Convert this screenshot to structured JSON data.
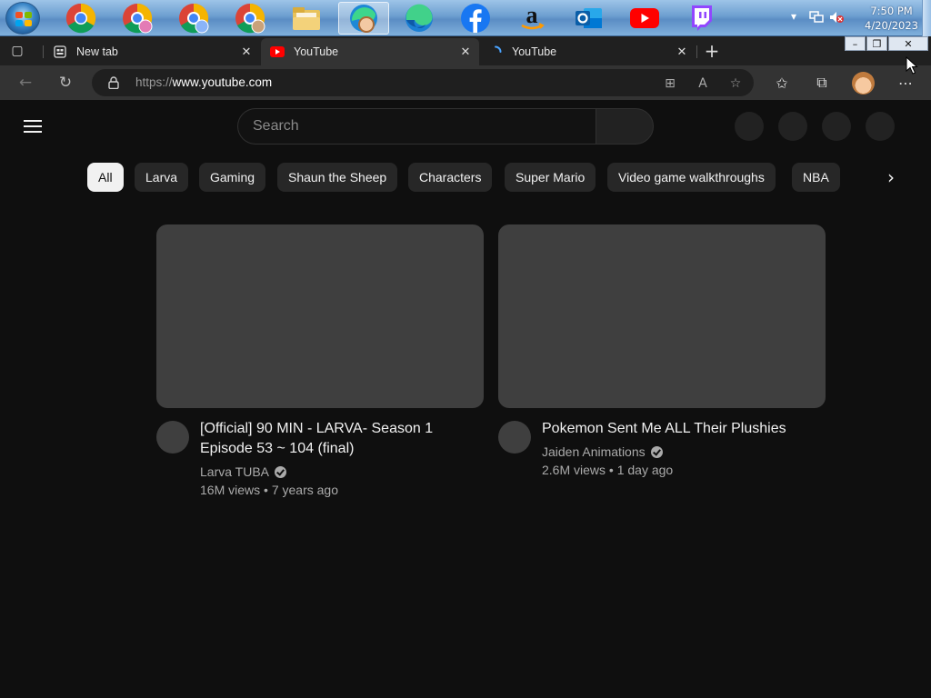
{
  "taskbar": {
    "apps": [
      {
        "name": "Google Chrome",
        "icon": "chrome-icon"
      },
      {
        "name": "Chrome profile 2",
        "icon": "chrome-profile-icon"
      },
      {
        "name": "Chrome profile 3",
        "icon": "chrome-profile-icon"
      },
      {
        "name": "Chrome profile 4",
        "icon": "chrome-profile-icon"
      },
      {
        "name": "File Explorer",
        "icon": "folder-icon"
      },
      {
        "name": "Microsoft Edge (profile)",
        "icon": "edge-profile-icon",
        "active": true
      },
      {
        "name": "Microsoft Edge",
        "icon": "edge-icon"
      },
      {
        "name": "Facebook",
        "icon": "facebook-icon"
      },
      {
        "name": "Amazon",
        "icon": "amazon-icon"
      },
      {
        "name": "Outlook",
        "icon": "outlook-icon"
      },
      {
        "name": "YouTube",
        "icon": "youtube-icon"
      },
      {
        "name": "Twitch",
        "icon": "twitch-icon"
      }
    ],
    "clock": {
      "time": "7:50 PM",
      "date": "4/20/2023"
    },
    "tray_icons": [
      "chevron-up-icon",
      "network-icon",
      "volume-muted-icon"
    ]
  },
  "browser": {
    "tabs": [
      {
        "label": "New tab",
        "icon": "new-tab-page-icon",
        "selected": false
      },
      {
        "label": "YouTube",
        "icon": "youtube-favicon",
        "selected": true
      },
      {
        "label": "YouTube",
        "icon": "loading-spinner-icon",
        "selected": false
      }
    ],
    "window_controls": {
      "minimize": "–",
      "restore": "❐",
      "close": "✕"
    },
    "address": {
      "prefix": "https://",
      "host": "www.youtube.com"
    },
    "toolbar_icons": [
      "apps-icon",
      "read-aloud-icon",
      "add-favorite-icon",
      "favorites-icon",
      "collections-icon",
      "profile-avatar",
      "more-icon"
    ]
  },
  "youtube": {
    "search_placeholder": "Search",
    "chips": [
      "All",
      "Larva",
      "Gaming",
      "Shaun the Sheep",
      "Characters",
      "Super Mario",
      "Video game walkthroughs",
      "NBA"
    ],
    "active_chip": "All",
    "videos": [
      {
        "title": "[Official] 90 MIN - LARVA- Season 1 Episode 53 ~ 104 (final)",
        "channel": "Larva TUBA",
        "verified": true,
        "views": "16M views",
        "age": "7 years ago"
      },
      {
        "title": "Pokemon Sent Me ALL Their Plushies",
        "channel": "Jaiden Animations",
        "verified": true,
        "views": "2.6M views",
        "age": "1 day ago"
      }
    ]
  },
  "colors": {
    "yt_background": "#0f0f0f",
    "chip_background": "#272727",
    "chip_active": "#f1f1f1",
    "placeholder_gray": "#3f3f3f",
    "youtube_red": "#ff0000"
  }
}
